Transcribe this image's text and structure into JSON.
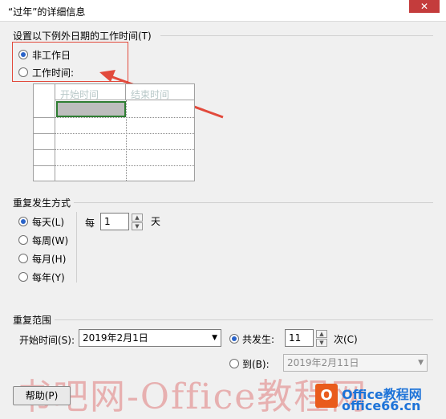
{
  "window": {
    "title": "“过年”的详细信息",
    "close_glyph": "✕"
  },
  "work_time_group": {
    "label": "设置以下例外日期的工作时间(T)",
    "option_nonworking": "非工作日",
    "option_working": "工作时间:",
    "selected": "nonworking",
    "columns": [
      "开始时间",
      "结束时间"
    ]
  },
  "recurrence": {
    "label": "重复发生方式",
    "options": [
      "每天(L)",
      "每周(W)",
      "每月(H)",
      "每年(Y)"
    ],
    "selected_index": 0,
    "every_label": "每",
    "every_value": "1",
    "unit_label": "天"
  },
  "range": {
    "label": "重复范围",
    "start_label": "开始时间(S):",
    "start_value": "2019年2月1日",
    "occur_label": "共发生:",
    "occur_value": "11",
    "occur_unit": "次(C)",
    "end_label": "到(B):",
    "end_value": "2019年2月11日"
  },
  "footer": {
    "help_label": "帮助(P)"
  },
  "watermark": {
    "text": "书吧网-Office教程网",
    "logo_letter": "O",
    "logo_line1": "Office教程网",
    "logo_line2": "office66.cn"
  },
  "colors": {
    "accent": "#2a63c8",
    "annotation_red": "#e24a3c"
  }
}
